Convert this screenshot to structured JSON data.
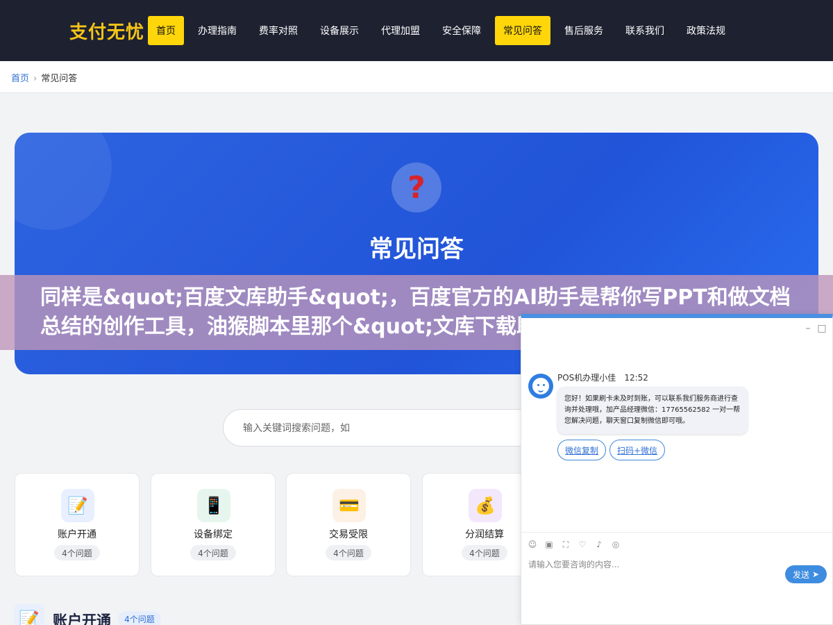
{
  "header": {
    "logo": "支付无忧",
    "nav": [
      {
        "label": "首页",
        "active": true
      },
      {
        "label": "办理指南",
        "active": false
      },
      {
        "label": "费率对照",
        "active": false
      },
      {
        "label": "设备展示",
        "active": false
      },
      {
        "label": "代理加盟",
        "active": false
      },
      {
        "label": "安全保障",
        "active": false
      },
      {
        "label": "常见问答",
        "active": true
      },
      {
        "label": "售后服务",
        "active": false
      },
      {
        "label": "联系我们",
        "active": false
      },
      {
        "label": "政策法规",
        "active": false
      }
    ],
    "accent_color": "#ffd60a"
  },
  "breadcrumb": {
    "home": "首页",
    "separator": "›",
    "current": "常见问答"
  },
  "hero": {
    "icon": "question-mark-icon",
    "title": "常见问答",
    "subtitle": ""
  },
  "overlay": {
    "text": "同样是&quot;百度文库助手&quot;，百度官方的AI助手是帮你写PPT和做文档总结的创作工具，油猴脚本里那个&quot;文库下载助手&quot;才"
  },
  "search": {
    "placeholder": "输入关键词搜索问题，如"
  },
  "categories": [
    {
      "icon": "memo-icon",
      "label": "账户开通",
      "count": "4个问题",
      "icon_bg": "#e8efff"
    },
    {
      "icon": "phone-icon",
      "label": "设备绑定",
      "count": "4个问题",
      "icon_bg": "#e6f6ee"
    },
    {
      "icon": "credit-card-icon",
      "label": "交易受限",
      "count": "4个问题",
      "icon_bg": "#fdf0e4"
    },
    {
      "icon": "money-bag-icon",
      "label": "分润结算",
      "count": "4个问题",
      "icon_bg": "#f3e8fb"
    }
  ],
  "section": {
    "icon": "memo-icon",
    "title": "账户开通",
    "count": "4个问题"
  },
  "chat": {
    "agent_name": "POS机办理小佳",
    "time": "12:52",
    "message": "您好！如果刷卡未及时到账，可以联系我们服务商进行查询并处理哦，加产品经理微信：17765562582 一对一帮您解决问题，聊天窗口复制微信即可哦。",
    "buttons": [
      "微信复制",
      "扫码+微信"
    ],
    "input_placeholder": "请输入您要咨询的内容...",
    "send_label": "发送",
    "minimize": "–",
    "maximize": "□",
    "tools": [
      "emoji-icon",
      "image-icon",
      "screenshot-icon",
      "rating-icon",
      "mute-icon",
      "wechat-icon"
    ]
  }
}
